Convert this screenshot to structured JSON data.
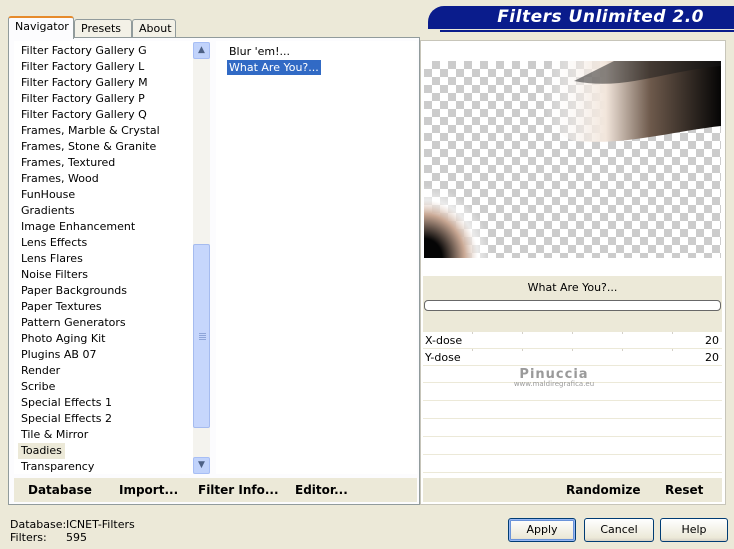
{
  "tabs": [
    {
      "label": "Navigator",
      "active": true
    },
    {
      "label": "Presets",
      "active": false
    },
    {
      "label": "About",
      "active": false
    }
  ],
  "banner": {
    "title": "Filters Unlimited 2.0",
    "color": "#0a1c8c"
  },
  "categories": [
    "Filter Factory Gallery G",
    "Filter Factory Gallery L",
    "Filter Factory Gallery M",
    "Filter Factory Gallery P",
    "Filter Factory Gallery Q",
    "Frames, Marble & Crystal",
    "Frames, Stone & Granite",
    "Frames, Textured",
    "Frames, Wood",
    "FunHouse",
    "Gradients",
    "Image Enhancement",
    "Lens Effects",
    "Lens Flares",
    "Noise Filters",
    "Paper Backgrounds",
    "Paper Textures",
    "Pattern Generators",
    "Photo Aging Kit",
    "Plugins AB 07",
    "Render",
    "Scribe",
    "Special Effects 1",
    "Special Effects 2",
    "Tile & Mirror",
    "Toadies",
    "Transparency"
  ],
  "selected_category": "Toadies",
  "filters": [
    "Blur 'em!...",
    "What Are You?..."
  ],
  "selected_filter": "What Are You?...",
  "nav_buttons": {
    "database": "Database",
    "import": "Import...",
    "filter_info": "Filter Info...",
    "editor": "Editor..."
  },
  "preview": {
    "caption": "What Are You?..."
  },
  "params": [
    {
      "label": "X-dose",
      "value": "20"
    },
    {
      "label": "Y-dose",
      "value": "20"
    }
  ],
  "watermark": {
    "name": "Pinuccia",
    "url": "www.maldiregrafica.eu"
  },
  "right_buttons": {
    "randomize": "Randomize",
    "reset": "Reset"
  },
  "status": {
    "database_label": "Database:",
    "database_value": "ICNET-Filters",
    "filters_label": "Filters:",
    "filters_value": "595"
  },
  "dialog_buttons": {
    "apply": "Apply",
    "cancel": "Cancel",
    "help": "Help"
  },
  "colors": {
    "selection": "#316ac5",
    "dialog_bg": "#ece9d8",
    "accent_tab": "#e68b2c"
  }
}
